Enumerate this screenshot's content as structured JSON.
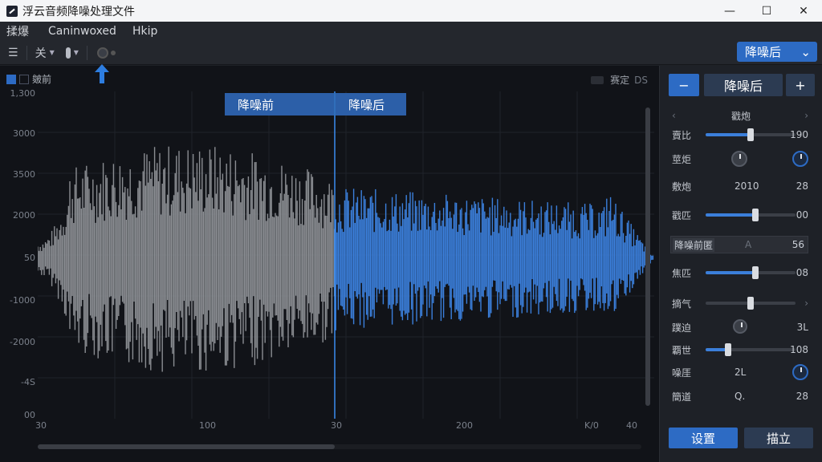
{
  "window": {
    "title": "浮云音频降噪处理文件",
    "minimize": "—",
    "maximize": "☐",
    "close": "✕"
  },
  "menu": {
    "items": [
      "揉爆",
      "Caninwoxed",
      "Hkip"
    ]
  },
  "toolbar": {
    "list_icon": "☰",
    "filter_label": "关",
    "mode_select": {
      "value": "降噪后",
      "chevron": "⌄"
    }
  },
  "panel": {
    "left_label": "皴前",
    "right_label": "赛定",
    "right_suffix": "DS"
  },
  "tags": {
    "before": "降噪前",
    "after": "降噪后"
  },
  "y_axis": [
    "1,300",
    "3000",
    "3500",
    "2000",
    "50",
    "-1000",
    "-2000",
    "-4S",
    "00"
  ],
  "x_axis": [
    "30",
    "100",
    "30",
    "200",
    "K/0",
    "40"
  ],
  "colors": {
    "before": "#8a8d92",
    "after": "#3b7fdb",
    "accent": "#2d6bc4"
  },
  "right_panel": {
    "top_minus": "−",
    "top_mode": "降噪后",
    "top_plus": "+",
    "nav_prev": "‹",
    "nav_title": "戳炮",
    "nav_next": "›",
    "rows": [
      {
        "label": "賣比",
        "value": "190"
      },
      {
        "label": "莖炬",
        "value": ""
      },
      {
        "label": "敷炮",
        "mid": "2010",
        "value": "28"
      },
      {
        "label": "戳匹",
        "value": "00"
      },
      {
        "label": "降噪前匿",
        "mid": "A",
        "value": "56"
      },
      {
        "label": "焦匹",
        "value": "08"
      },
      {
        "label": "摘气",
        "value": "›"
      },
      {
        "label": "蹼迫",
        "mid": "",
        "value": "3L"
      },
      {
        "label": "覇世",
        "value": "108"
      },
      {
        "label": "噪厓",
        "mid": "2L",
        "value": ""
      },
      {
        "label": "簡道",
        "mid": "Q.",
        "value": "28"
      }
    ],
    "slider_levels": {
      "row1": 0.5,
      "row4": 0.55,
      "row6": 0.55,
      "row7": 0.5,
      "row9": 0.25
    },
    "bottom_left": "设置",
    "bottom_right": "描立"
  }
}
